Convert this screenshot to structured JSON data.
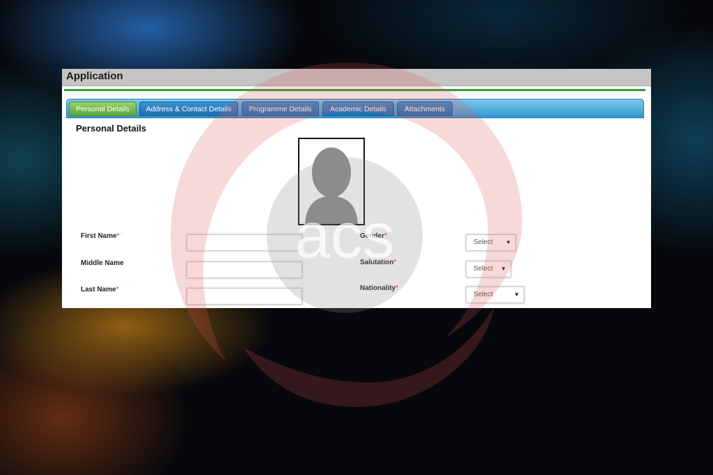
{
  "window": {
    "title": "Application"
  },
  "tabs": [
    {
      "label": "Personal Details",
      "active": true
    },
    {
      "label": "Address & Contact Details",
      "active": false
    },
    {
      "label": "Programme Details",
      "active": false
    },
    {
      "label": "Academic Details",
      "active": false
    },
    {
      "label": "Attachments",
      "active": false
    }
  ],
  "section": {
    "title": "Personal Details"
  },
  "fields": {
    "first_name": {
      "label": "First Name",
      "required": "*",
      "value": ""
    },
    "middle_name": {
      "label": "Middle Name",
      "value": ""
    },
    "last_name": {
      "label": "Last Name",
      "required": "*",
      "value": ""
    },
    "gender": {
      "label": "Gender",
      "required": "*",
      "selected": "Select"
    },
    "salutation": {
      "label": "Salutation",
      "required": "*",
      "selected": "Select"
    },
    "nationality": {
      "label": "Nationality",
      "required": "*",
      "selected": "Select"
    }
  },
  "watermark": {
    "text": "acs"
  },
  "colors": {
    "tab_active": "#5aa63a",
    "tab_inactive": "#1f6fb2",
    "accent_line": "#2e9e2e",
    "required_mark": "#dd1111",
    "watermark": "#e88888"
  },
  "icons": {
    "photo": "avatar-placeholder-icon",
    "dropdown": "caret-down-icon"
  }
}
